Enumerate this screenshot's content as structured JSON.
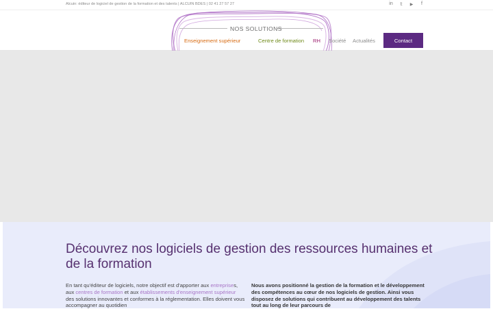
{
  "topbar": {
    "text": "Alcuin: éditeur de logiciel de gestion de la formation et des talents | ALCUIN BDES | 02 41 27 57 27",
    "social": [
      "in",
      "𝕥",
      "▶",
      "f"
    ],
    "social_icons": [
      "linkedin-icon",
      "twitter-icon",
      "youtube-icon",
      "facebook-icon"
    ]
  },
  "nav": {
    "solutions_title": "NOS SOLUTIONS",
    "items": [
      "Enseignement supérieur",
      "Centre de formation",
      "RH",
      "Société",
      "Actualités"
    ],
    "contact": "Contact",
    "colors": {
      "enseignement": "#d76b12",
      "centre": "#6f8a1a",
      "rh": "#9c1d6e",
      "contact_bg": "#5c2a82"
    }
  },
  "section": {
    "heading": "Découvrez nos logiciels de gestion des ressources humaines et de la formation",
    "left": {
      "t1": "En tant qu'éditeur de logiciels, notre objectif est d'apporter aux ",
      "link1": "entreprise",
      "t2": "s, aux ",
      "link2": "centres de formation",
      "t3": " et aux ",
      "link3": "établissements d'enseignement supérieur",
      "t4": " des solutions innovantes et conformes à la réglementation. Elles doivent vous accompagner au quotidien"
    },
    "right": "Nous avons positionné la gestion de la formation et le développement des compétences au cœur de nos logiciels de gestion. Ainsi vous disposez de solutions qui contribuent au développement des talents tout au long de leur parcours de"
  }
}
